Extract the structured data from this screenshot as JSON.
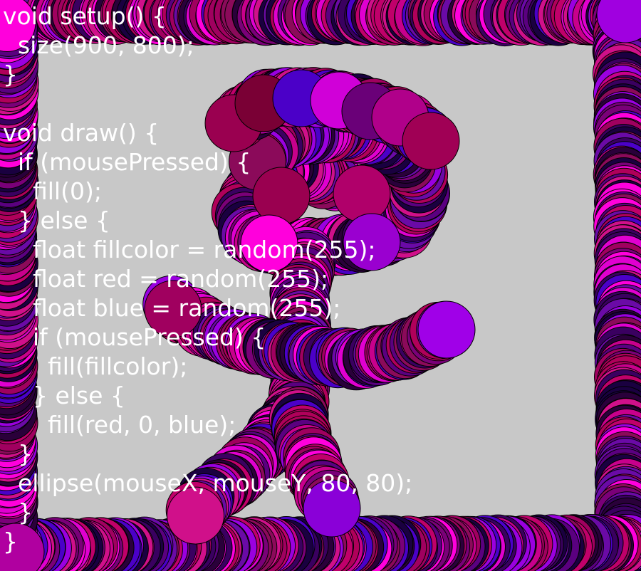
{
  "sketch": {
    "background_color": "#c8c8c8",
    "stroke_color": "#000000",
    "palette": [
      "#8b0a5a",
      "#a0005f",
      "#6a0aa6",
      "#4b00c8",
      "#c8008c",
      "#e000d0",
      "#9a00e0",
      "#2a003a",
      "#1a0040",
      "#b0005a",
      "#d0108a",
      "#7a0078",
      "#3a0060",
      "#ff00dc",
      "#5a0080",
      "#c0006a"
    ]
  },
  "code": {
    "text_color": "#ffffff",
    "lines": [
      "void setup() {",
      "  size(900, 800);",
      "}",
      "",
      "void draw() {",
      "  if (mousePressed) {",
      "    fill(0);",
      "  } else {",
      "    float fillcolor = random(255);",
      "    float red = random(255);",
      "    float blue = random(255);",
      "    if (mousePressed) {",
      "      fill(fillcolor);",
      "    } else {",
      "      fill(red, 0, blue);",
      "  }",
      "  ellipse(mouseX, mouseY, 80, 80);",
      "  }",
      "}"
    ]
  }
}
